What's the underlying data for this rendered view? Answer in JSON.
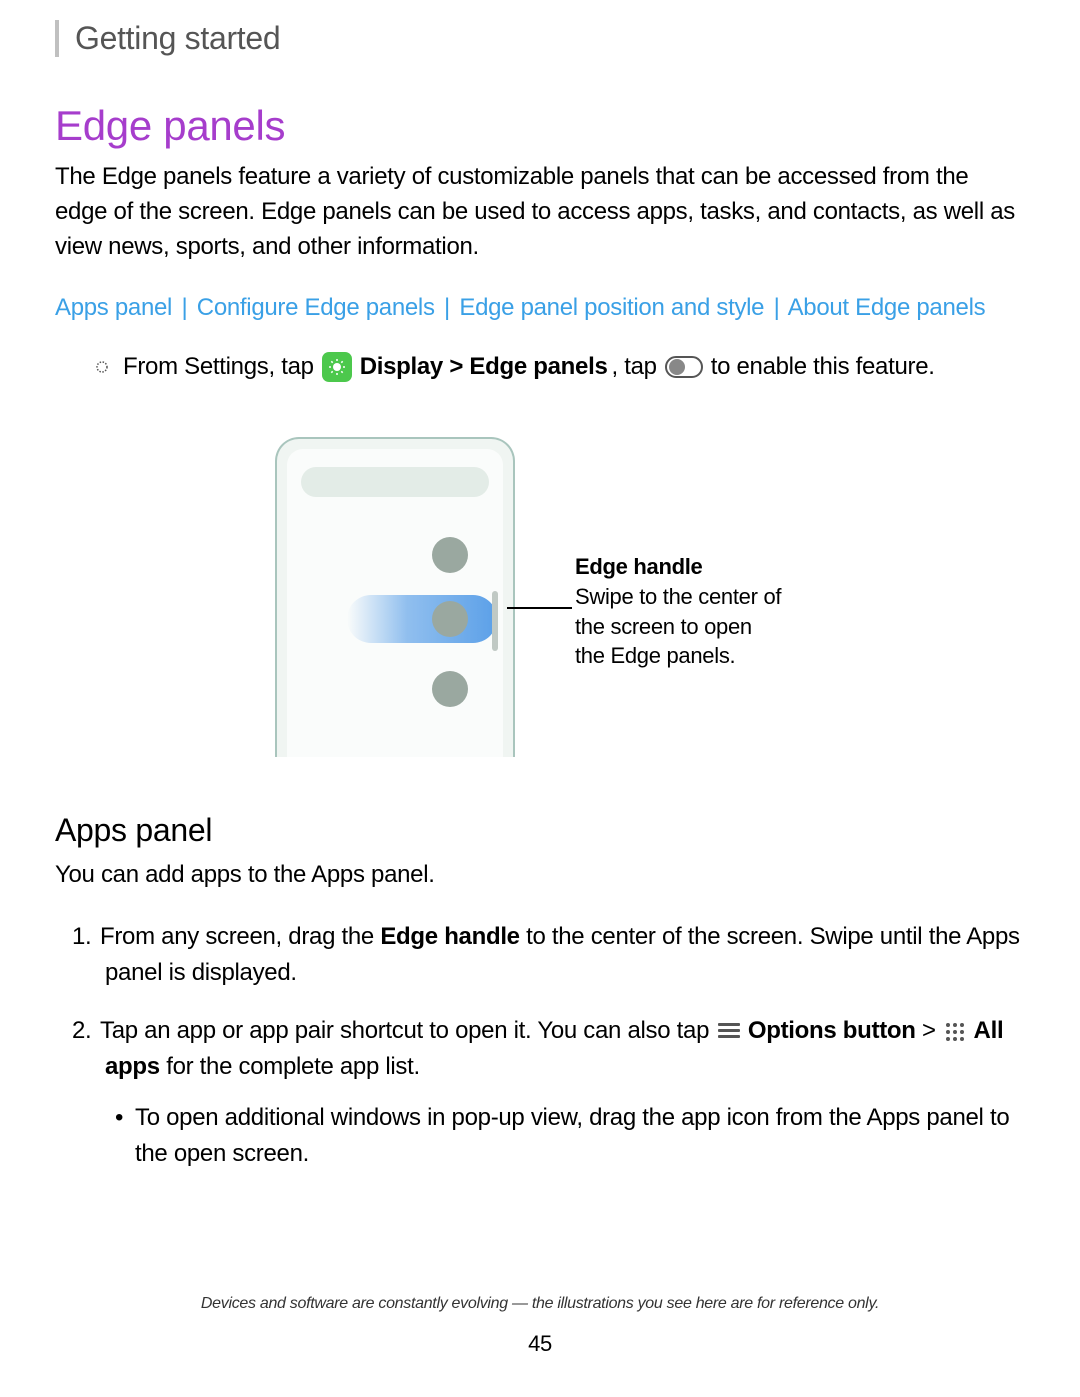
{
  "breadcrumb": "Getting started",
  "heading": "Edge panels",
  "intro": "The Edge panels feature a variety of customizable panels that can be accessed from the edge of the screen. Edge panels can be used to access apps, tasks, and contacts, as well as view news, sports, and other information.",
  "links": {
    "l1": "Apps panel",
    "l2": "Configure Edge panels",
    "l3": "Edge panel position and style",
    "l4": "About Edge panels",
    "sep": "|"
  },
  "instruction": {
    "pre": "From Settings, tap",
    "bold1": " Display > Edge panels",
    "mid": ", tap",
    "post": " to enable this feature."
  },
  "callout": {
    "title": "Edge handle",
    "body": "Swipe to the center of the screen to open the Edge panels."
  },
  "subheading": "Apps panel",
  "subtext": "You can add apps to the Apps panel.",
  "step1": {
    "num": "1.",
    "pre": "From any screen, drag the ",
    "bold": "Edge handle",
    "post": " to the center of the screen. Swipe until the Apps panel is displayed."
  },
  "step2": {
    "num": "2.",
    "pre": "Tap an app or app pair shortcut to open it. You can also tap",
    "bold1": " Options button",
    "sep": " > ",
    "bold2": " All apps",
    "post": " for the complete app list."
  },
  "subbullet": "To open additional windows in pop-up view, drag the app icon from the Apps panel to the open screen.",
  "footer": {
    "note": "Devices and software are constantly evolving — the illustrations you see here are for reference only.",
    "page": "45"
  }
}
